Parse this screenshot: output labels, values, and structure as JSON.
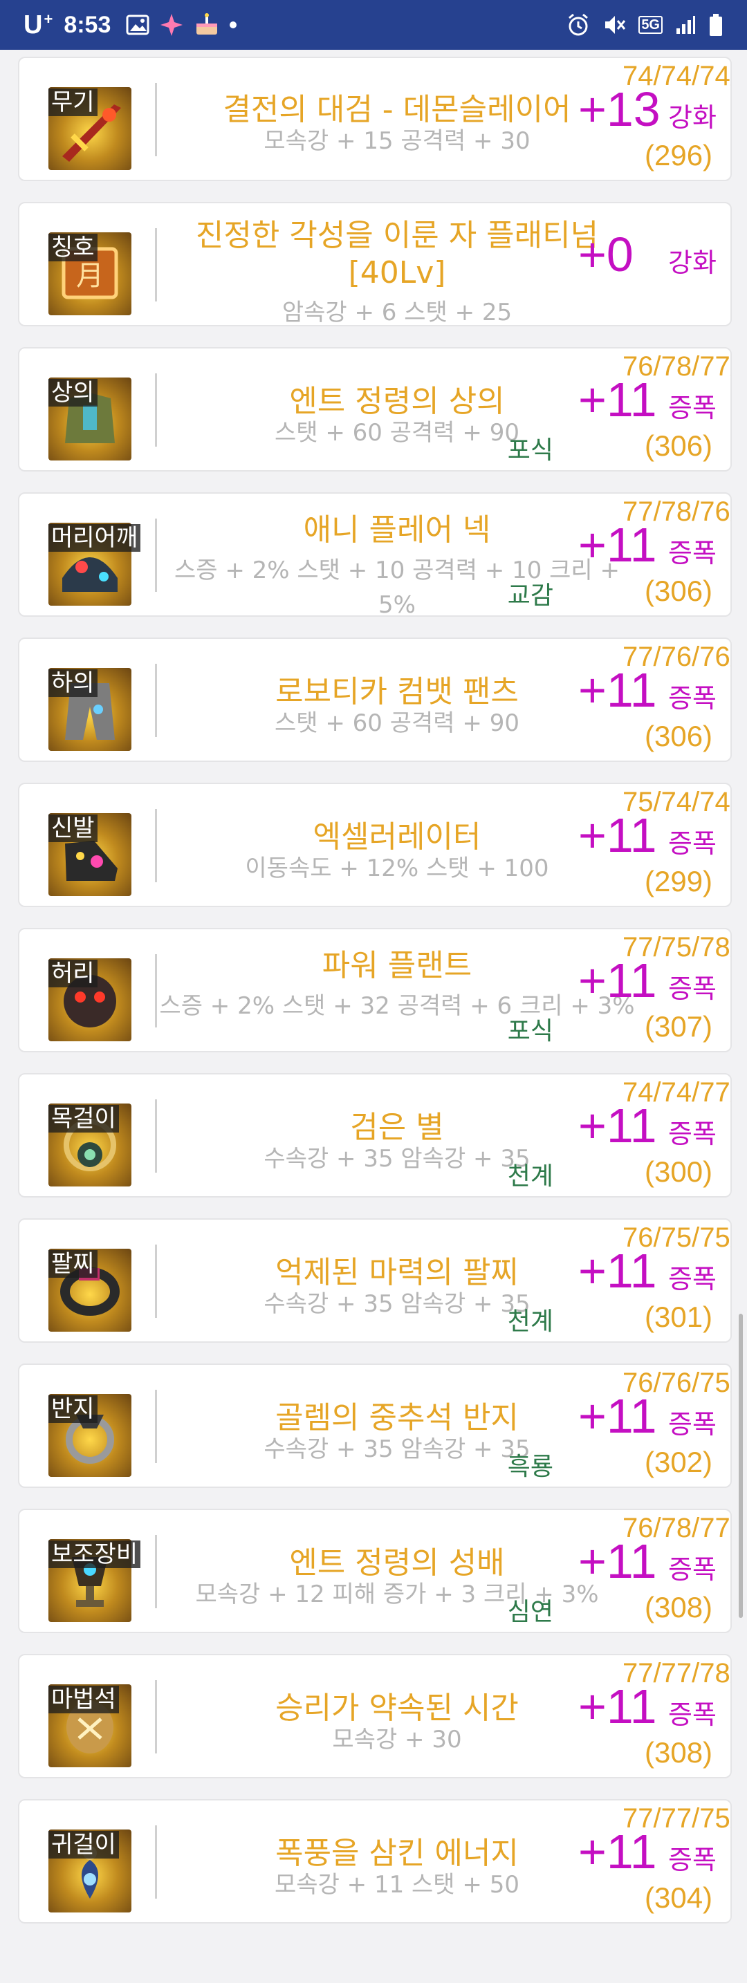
{
  "status_bar": {
    "carrier": "U",
    "carrier_sup": "+",
    "time": "8:53",
    "network": "5G"
  },
  "items": [
    {
      "slot": "무기",
      "name": "결전의 대검 - 데몬슬레이어",
      "stats": "모속강 + 15 공격력 + 30",
      "potential": "",
      "enhance": "+13",
      "enhance_type": "강화",
      "stars": "74/74/74/",
      "total": "(296)",
      "icon": "sword-icon",
      "icon_color": "#a8281e"
    },
    {
      "slot": "칭호",
      "name": "진정한 각성을 이룬 자 플래티넘 [40Lv]",
      "stats": "암속강 + 6 스탯 + 25",
      "potential": "",
      "enhance": "+0",
      "enhance_type": "강화",
      "stars": "",
      "total": "",
      "icon": "title-icon",
      "icon_color": "#c7651c"
    },
    {
      "slot": "상의",
      "name": "엔트 정령의 상의",
      "stats": "스탯 + 60 공격력 + 90",
      "potential": "포식",
      "enhance": "+11",
      "enhance_type": "증폭",
      "stars": "76/78/77/",
      "total": "(306)",
      "icon": "armor-top-icon",
      "icon_color": "#6d7a3c"
    },
    {
      "slot": "머리어깨",
      "name": "애니 플레어 넥",
      "stats": "스증 + 2% 스탯 + 10 공격력 + 10 크리 + 5%",
      "potential": "교감",
      "enhance": "+11",
      "enhance_type": "증폭",
      "stars": "77/78/76/",
      "total": "(306)",
      "icon": "shoulder-icon",
      "icon_color": "#2b3a4a"
    },
    {
      "slot": "하의",
      "name": "로보티카 컴뱃 팬츠",
      "stats": "스탯 + 60 공격력 + 90",
      "potential": "",
      "enhance": "+11",
      "enhance_type": "증폭",
      "stars": "77/76/76/",
      "total": "(306)",
      "icon": "pants-icon",
      "icon_color": "#7d7d7d"
    },
    {
      "slot": "신발",
      "name": "엑셀러레이터",
      "stats": "이동속도 + 12% 스탯 + 100",
      "potential": "",
      "enhance": "+11",
      "enhance_type": "증폭",
      "stars": "75/74/74/",
      "total": "(299)",
      "icon": "shoes-icon",
      "icon_color": "#2a2a2a"
    },
    {
      "slot": "허리",
      "name": "파워 플랜트",
      "stats": "스증 + 2% 스탯 + 32 공격력 + 6 크리 + 3%",
      "potential": "포식",
      "enhance": "+11",
      "enhance_type": "증폭",
      "stars": "77/75/78/",
      "total": "(307)",
      "icon": "belt-icon",
      "icon_color": "#3a2a28"
    },
    {
      "slot": "목걸이",
      "name": "검은 별",
      "stats": "수속강 + 35 암속강 + 35",
      "potential": "천계",
      "enhance": "+11",
      "enhance_type": "증폭",
      "stars": "74/74/77/",
      "total": "(300)",
      "icon": "necklace-icon",
      "icon_color": "#2e4a3e"
    },
    {
      "slot": "팔찌",
      "name": "억제된 마력의 팔찌",
      "stats": "수속강 + 35 암속강 + 35",
      "potential": "천계",
      "enhance": "+11",
      "enhance_type": "증폭",
      "stars": "76/75/75/",
      "total": "(301)",
      "icon": "bracelet-icon",
      "icon_color": "#c2306a"
    },
    {
      "slot": "반지",
      "name": "골렘의 중추석 반지",
      "stats": "수속강 + 35 암속강 + 35",
      "potential": "흑룡",
      "enhance": "+11",
      "enhance_type": "증폭",
      "stars": "76/76/75/",
      "total": "(302)",
      "icon": "ring-icon",
      "icon_color": "#3a3a3a"
    },
    {
      "slot": "보조장비",
      "name": "엔트 정령의 성배",
      "stats": "모속강 + 12 피해 증가 + 3 크리 + 3%",
      "potential": "심연",
      "enhance": "+11",
      "enhance_type": "증폭",
      "stars": "76/78/77/",
      "total": "(308)",
      "icon": "chalice-icon",
      "icon_color": "#3c3020"
    },
    {
      "slot": "마법석",
      "name": "승리가 약속된 시간",
      "stats": "모속강 + 30",
      "potential": "",
      "enhance": "+11",
      "enhance_type": "증폭",
      "stars": "77/77/78/",
      "total": "(308)",
      "icon": "magic-stone-icon",
      "icon_color": "#c99a4a"
    },
    {
      "slot": "귀걸이",
      "name": "폭풍을 삼킨 에너지",
      "stats": "모속강 + 11 스탯 + 50",
      "potential": "",
      "enhance": "+11",
      "enhance_type": "증폭",
      "stars": "77/77/75/",
      "total": "(304)",
      "icon": "earring-icon",
      "icon_color": "#2d4a8a"
    }
  ]
}
